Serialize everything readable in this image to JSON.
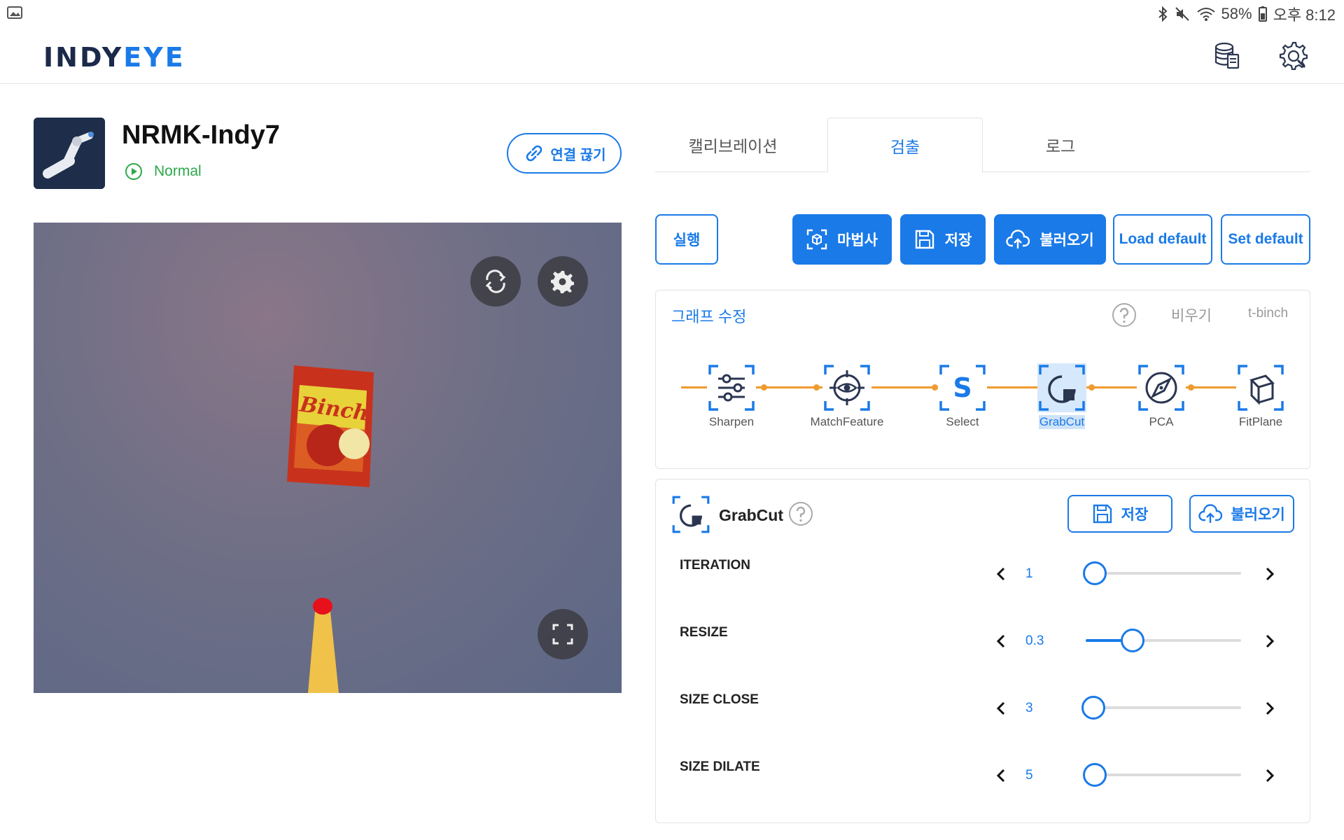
{
  "status_bar": {
    "battery": "58%",
    "time": "오후 8:12",
    "icons": [
      "gallery-icon",
      "bluetooth-icon",
      "mute-icon",
      "wifi-icon",
      "battery-icon"
    ]
  },
  "header": {
    "logo_part1": "INDY",
    "logo_part2": "EYE",
    "icons": [
      "database-icon",
      "settings-icon"
    ]
  },
  "robot": {
    "name": "NRMK-Indy7",
    "status": "Normal",
    "disconnect_label": "연결 끊기"
  },
  "tabs": [
    {
      "label": "캘리브레이션",
      "active": false
    },
    {
      "label": "검출",
      "active": true
    },
    {
      "label": "로그",
      "active": false
    }
  ],
  "toolbar": {
    "run": "실행",
    "wizard": "마법사",
    "save": "저장",
    "load": "불러오기",
    "load_default": "Load default",
    "set_default": "Set default"
  },
  "graph": {
    "title": "그래프 수정",
    "clear": "비우기",
    "name": "t-binch",
    "nodes": [
      {
        "label": "Sharpen",
        "icon": "sliders-icon",
        "selected": false
      },
      {
        "label": "MatchFeature",
        "icon": "target-eye-icon",
        "selected": false
      },
      {
        "label": "Select",
        "icon": "letter-s-icon",
        "selected": false
      },
      {
        "label": "GrabCut",
        "icon": "grabcut-icon",
        "selected": true
      },
      {
        "label": "PCA",
        "icon": "compass-icon",
        "selected": false
      },
      {
        "label": "FitPlane",
        "icon": "cube-icon",
        "selected": false
      }
    ]
  },
  "grabcut": {
    "title": "GrabCut",
    "save": "저장",
    "load": "불러오기",
    "params": [
      {
        "label": "ITERATION",
        "value": "1",
        "level": 0.0
      },
      {
        "label": "RESIZE",
        "value": "0.3",
        "level": 0.3
      },
      {
        "label": "SIZE CLOSE",
        "value": "3",
        "level": 0.05
      },
      {
        "label": "SIZE DILATE",
        "value": "5",
        "level": 0.0
      }
    ]
  },
  "camera": {
    "product_text": "Binch"
  },
  "colors": {
    "accent": "#1a7ae8",
    "status_ok": "#2ca84a",
    "pipeline": "#f09a2e",
    "logo_dark": "#1b2a4a"
  }
}
